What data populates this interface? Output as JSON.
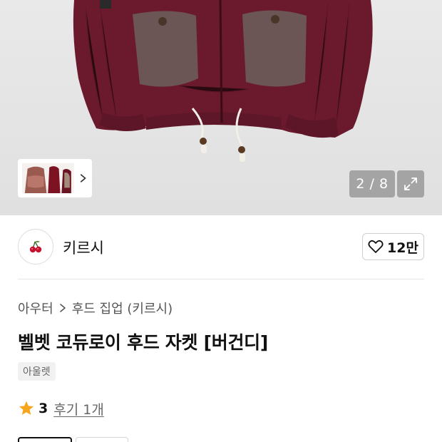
{
  "gallery": {
    "image_alt": "벨벳 코듀로이 후드 자켓 [버건디]",
    "page_counter": "2 / 8",
    "thumbnail_icon": "product-thumbnail-icon",
    "next_icon": "chevron-right-icon",
    "expand_icon": "expand-icon"
  },
  "brand": {
    "name": "키르시",
    "logo_icon": "cherry-icon",
    "like_icon": "heart-icon",
    "like_count": "12만"
  },
  "breadcrumb": {
    "items": [
      "아우터",
      "후드 집업 (키르시)"
    ],
    "separator_icon": "chevron-right-icon"
  },
  "product": {
    "title": "벨벳 코듀로이 후드 자켓 [버건디]",
    "badge": "아울렛"
  },
  "rating": {
    "star_icon": "star-icon",
    "value": "3",
    "review_link": "후기 1개"
  },
  "colors": {
    "burgundy": "#6d1a2e",
    "star": "#f7a51c",
    "counter_bg": "#8c8c8c"
  }
}
